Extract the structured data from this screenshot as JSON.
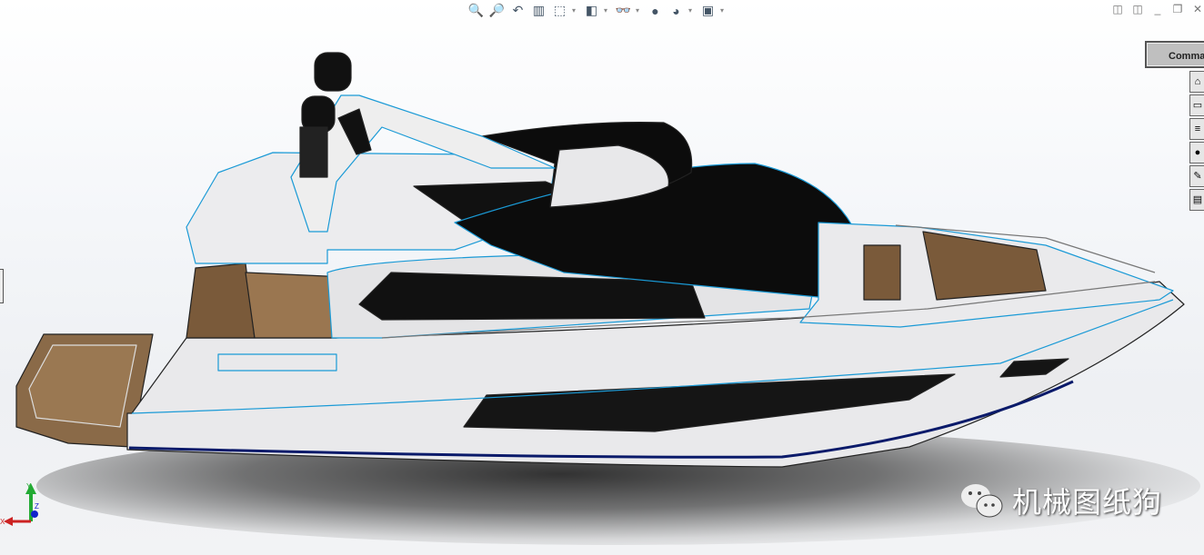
{
  "toolbar": {
    "items": [
      {
        "icon": "zoom-to-fit-icon",
        "glyph": "🔍"
      },
      {
        "icon": "zoom-to-area-icon",
        "glyph": "🔎"
      },
      {
        "icon": "previous-view-icon",
        "glyph": "↶"
      },
      {
        "icon": "section-view-icon",
        "glyph": "▥"
      },
      {
        "icon": "view-orientation-icon",
        "glyph": "⬚",
        "dropdown": true
      },
      {
        "icon": "display-style-icon",
        "glyph": "◧",
        "dropdown": true
      },
      {
        "icon": "hide-show-items-icon",
        "glyph": "👓",
        "dropdown": true
      },
      {
        "icon": "edit-appearance-icon",
        "glyph": "●"
      },
      {
        "icon": "apply-scene-icon",
        "glyph": "◕",
        "dropdown": true
      },
      {
        "icon": "view-settings-icon",
        "glyph": "▣",
        "dropdown": true
      }
    ]
  },
  "window_controls": {
    "glyphs": [
      "◫",
      "◫",
      "_",
      "❐",
      "✕"
    ]
  },
  "command_manager": {
    "label": "Comma"
  },
  "task_pane": {
    "icons": [
      "solidworks-resources-icon",
      "design-library-icon",
      "file-explorer-icon",
      "view-palette-icon",
      "appearances-icon",
      "custom-properties-icon"
    ],
    "glyphs": [
      "⌂",
      "▭",
      "≡",
      "●",
      "✎",
      "▤"
    ]
  },
  "triad": {
    "x": "X",
    "y": "Y",
    "z": "Z",
    "colors": {
      "x": "#cc2222",
      "y": "#22aa33",
      "z": "#1122cc"
    }
  },
  "watermark": {
    "text": "机械图纸狗"
  },
  "colors": {
    "hull": "#e9e9eb",
    "edge": "#1a9ad6",
    "glass": "#101010",
    "teak": "#8a6a48",
    "stripe": "#0a1a6a"
  }
}
